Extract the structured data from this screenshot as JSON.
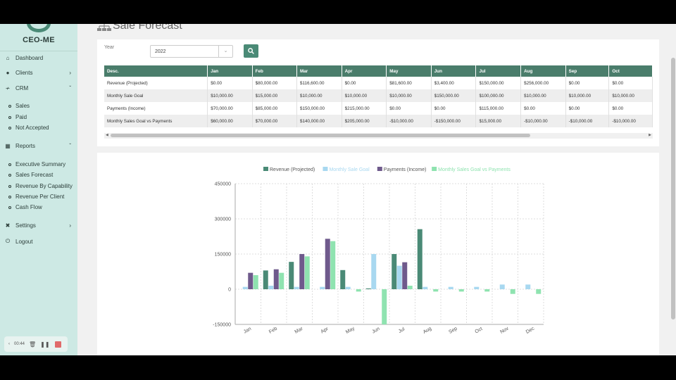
{
  "brand": {
    "name": "CEO-ME"
  },
  "nav": {
    "dashboard": "Dashboard",
    "clients": "Clients",
    "crm": "CRM",
    "crm_items": [
      "Sales",
      "Paid",
      "Not Accepted"
    ],
    "reports": "Reports",
    "report_items": [
      "Executive Summary",
      "Sales Forecast",
      "Revenue By Capability",
      "Revenue Per Client",
      "Cash Flow"
    ],
    "settings": "Settings",
    "logout": "Logout"
  },
  "recorder": {
    "time": "00:44"
  },
  "page": {
    "title": "Sale Forecast"
  },
  "filter": {
    "year_label": "Year",
    "year_value": "2022"
  },
  "table": {
    "headers": [
      "Desc.",
      "Jan",
      "Feb",
      "Mar",
      "Apr",
      "May",
      "Jun",
      "Jul",
      "Aug",
      "Sep",
      "Oct"
    ],
    "rows": [
      [
        "Revenue (Projected)",
        "$0.00",
        "$80,000.00",
        "$116,600.00",
        "$0.00",
        "$81,600.00",
        "$3,400.00",
        "$150,000.00",
        "$256,000.00",
        "$0.00",
        "$0.00"
      ],
      [
        "Monthly Sale Goal",
        "$10,000.00",
        "$15,000.00",
        "$10,000.00",
        "$10,000.00",
        "$10,000.00",
        "$150,000.00",
        "$100,000.00",
        "$10,000.00",
        "$10,000.00",
        "$10,000.00"
      ],
      [
        "Payments (Income)",
        "$70,000.00",
        "$85,000.00",
        "$150,000.00",
        "$215,000.00",
        "$0.00",
        "$0.00",
        "$115,000.00",
        "$0.00",
        "$0.00",
        "$0.00"
      ],
      [
        "Monthly Sales Goal vs Payments",
        "$60,000.00",
        "$70,000.00",
        "$140,000.00",
        "$205,000.00",
        "-$10,000.00",
        "-$150,000.00",
        "$15,000.00",
        "-$10,000.00",
        "-$10,000.00",
        "-$10,000.00"
      ]
    ]
  },
  "colors": {
    "revenue": "#4a8a76",
    "goal": "#a8d8f0",
    "payments": "#6f5a8c",
    "vs": "#8fe3b0",
    "accent": "#4a7d6b"
  },
  "chart_data": {
    "type": "bar",
    "categories": [
      "Jan",
      "Feb",
      "Mar",
      "Apr",
      "May",
      "Jun",
      "Jul",
      "Aug",
      "Sep",
      "Oct",
      "Nov",
      "Dec"
    ],
    "series": [
      {
        "name": "Revenue (Projected)",
        "values": [
          0,
          80000,
          116600,
          0,
          81600,
          3400,
          150000,
          256000,
          0,
          0,
          0,
          0
        ]
      },
      {
        "name": "Monthly Sale Goal",
        "values": [
          10000,
          15000,
          10000,
          10000,
          10000,
          150000,
          100000,
          10000,
          10000,
          10000,
          20000,
          20000
        ]
      },
      {
        "name": "Payments (Income)",
        "values": [
          70000,
          85000,
          150000,
          215000,
          0,
          0,
          115000,
          0,
          0,
          0,
          0,
          0
        ]
      },
      {
        "name": "Monthly Sales Goal vs Payments",
        "values": [
          60000,
          70000,
          140000,
          205000,
          -10000,
          -150000,
          15000,
          -10000,
          -10000,
          -10000,
          -20000,
          -20000
        ]
      }
    ],
    "ylim": [
      -150000,
      450000
    ],
    "yticks": [
      "450000",
      "300000",
      "150000",
      "0",
      "-150000"
    ],
    "grid": true,
    "legend": "top"
  }
}
